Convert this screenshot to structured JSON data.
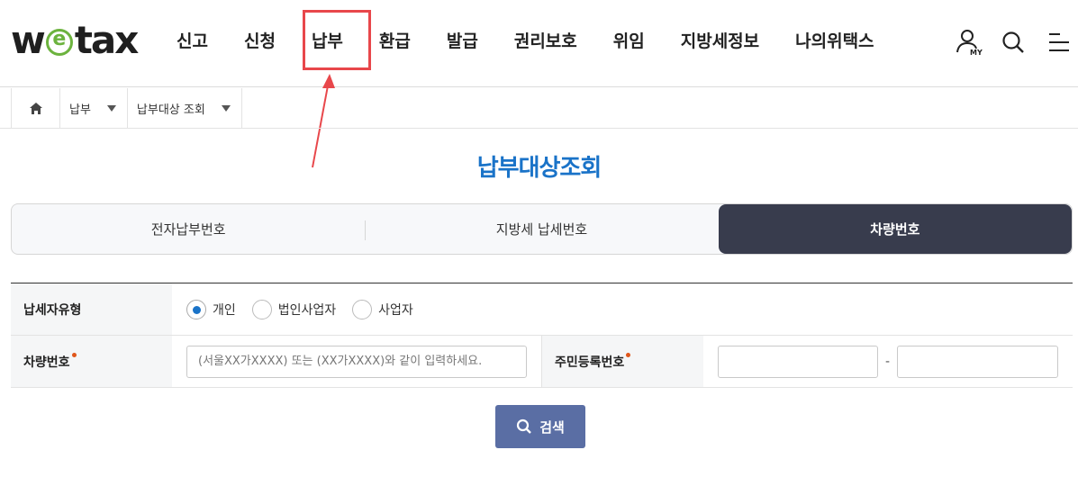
{
  "header": {
    "logo_prefix": "w",
    "logo_e": "e",
    "logo_suffix": "tax",
    "nav": [
      "신고",
      "신청",
      "납부",
      "환급",
      "발급",
      "권리보호",
      "위임",
      "지방세정보",
      "나의위택스"
    ],
    "highlighted_nav": "납부",
    "my_label": "MY",
    "icons": [
      "user-icon",
      "search-icon",
      "menu-icon"
    ]
  },
  "breadcrumb": {
    "home_icon": "home-icon",
    "items": [
      "납부",
      "납부대상 조회"
    ]
  },
  "page_title": "납부대상조회",
  "tabs": [
    {
      "label": "전자납부번호",
      "active": false
    },
    {
      "label": "지방세 납세번호",
      "active": false
    },
    {
      "label": "차량번호",
      "active": true
    }
  ],
  "form": {
    "taxpayer_type_label": "납세자유형",
    "taxpayer_options": [
      {
        "label": "개인",
        "checked": true
      },
      {
        "label": "법인사업자",
        "checked": false
      },
      {
        "label": "사업자",
        "checked": false
      }
    ],
    "vehicle_label": "차량번호",
    "vehicle_placeholder": "(서울XX가XXXX) 또는 (XX가XXXX)와 같이 입력하세요.",
    "resident_label": "주민등록번호",
    "resident_first": "",
    "resident_second": "",
    "dash": "-"
  },
  "search_button": "검색",
  "colors": {
    "accent": "#1a73c8",
    "active_tab": "#383c4d",
    "search_button": "#5a6ea4",
    "annotation": "#e8474b",
    "logo_green": "#6cb33e"
  }
}
